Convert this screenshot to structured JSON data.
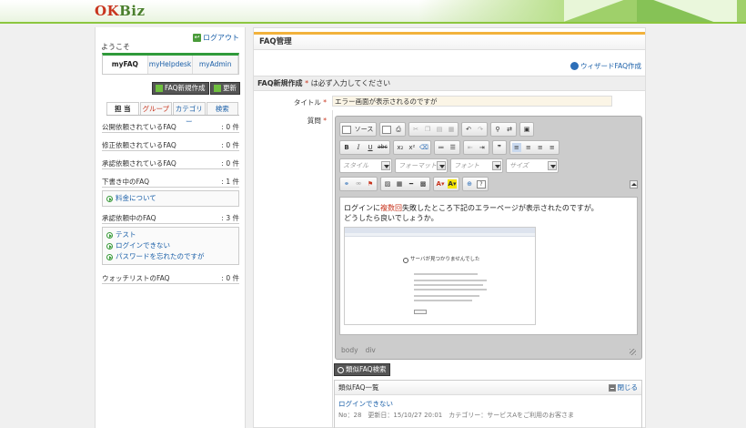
{
  "header": {
    "logo_ok": "OK",
    "logo_biz": "Biz"
  },
  "sidebar": {
    "logout": "ログアウト",
    "welcome": "ようこそ",
    "my_tabs": [
      "myFAQ",
      "myHelpdesk",
      "myAdmin"
    ],
    "new_faq_button": "FAQ新規作成",
    "refresh_button": "更新",
    "sub_tabs": [
      "担 当",
      "グループ",
      "カテゴリー",
      "検索"
    ],
    "sections": [
      {
        "label": "公開依頼されているFAQ",
        "count": ": 0 件",
        "items": []
      },
      {
        "label": "修正依頼されているFAQ",
        "count": ": 0 件",
        "items": []
      },
      {
        "label": "承認依頼されているFAQ",
        "count": ": 0 件",
        "items": []
      },
      {
        "label": "下書き中のFAQ",
        "count": ": 1 件",
        "items": [
          "料金について"
        ]
      },
      {
        "label": "承認依頼中のFAQ",
        "count": ": 3 件",
        "items": [
          "テスト",
          "ログインできない",
          "パスワードを忘れたのですが"
        ]
      },
      {
        "label": "ウォッチリストのFAQ",
        "count": ": 0 件",
        "items": []
      }
    ]
  },
  "main": {
    "title": "FAQ管理",
    "wizard_link": "ウィザードFAQ作成",
    "new_header": "FAQ新規作成",
    "required_note": "は必ず入力してください",
    "title_label": "タイトル",
    "title_value": "エラー画面が表示されるのですが",
    "question_label": "質問",
    "toolbar": {
      "source": "ソース",
      "style": "スタイル",
      "format": "フォーマット",
      "font": "フォント",
      "size": "サイズ"
    },
    "content": {
      "line1_pre": "ログインに",
      "line1_hl": "複数回",
      "line1_post": "失敗したところ下記のエラーページが表示されたのですが。",
      "line2": "どうしたら良いでしょうか。",
      "shot_title": "サーバが見つかりませんでした"
    },
    "status_path": [
      "body",
      "div"
    ],
    "similar_button": "類似FAQ検索",
    "similar_list_title": "類似FAQ一覧",
    "close_label": "閉じる",
    "similar_item": "ログインできない",
    "similar_meta": "No：28　更新日：15/10/27 20:01　カテゴリー：サービスAをご利用のお客さま"
  }
}
